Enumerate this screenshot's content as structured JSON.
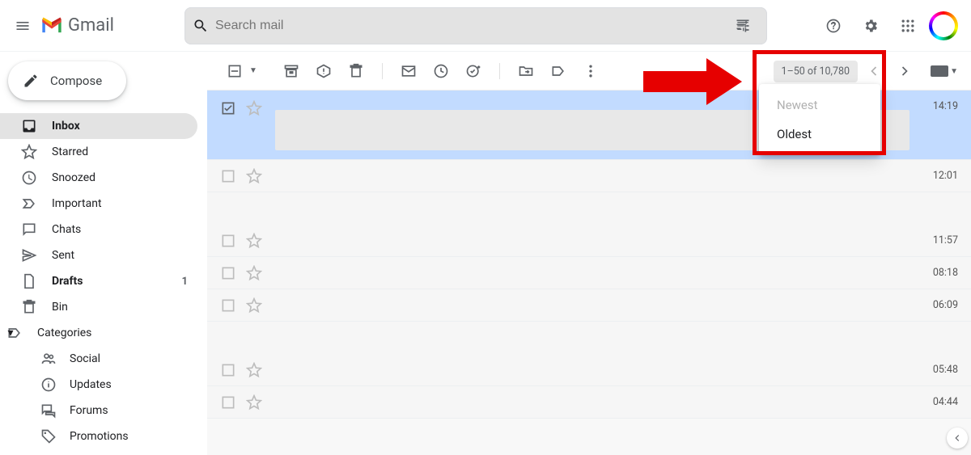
{
  "header": {
    "brand_text": "Gmail",
    "search_placeholder": "Search mail"
  },
  "compose": {
    "label": "Compose"
  },
  "sidebar": {
    "items": [
      {
        "id": "inbox",
        "label": "Inbox",
        "active": true,
        "bold": true
      },
      {
        "id": "starred",
        "label": "Starred"
      },
      {
        "id": "snoozed",
        "label": "Snoozed"
      },
      {
        "id": "important",
        "label": "Important"
      },
      {
        "id": "chats",
        "label": "Chats"
      },
      {
        "id": "sent",
        "label": "Sent"
      },
      {
        "id": "drafts",
        "label": "Drafts",
        "bold": true,
        "count": "1"
      },
      {
        "id": "bin",
        "label": "Bin"
      },
      {
        "id": "categories",
        "label": "Categories"
      }
    ],
    "categories": [
      {
        "id": "social",
        "label": "Social"
      },
      {
        "id": "updates",
        "label": "Updates"
      },
      {
        "id": "forums",
        "label": "Forums"
      },
      {
        "id": "promotions",
        "label": "Promotions"
      }
    ]
  },
  "toolbar": {
    "page_count": "1–50 of 10,780",
    "sort": {
      "newest": "Newest",
      "oldest": "Oldest"
    }
  },
  "emails": [
    {
      "selected": true,
      "time": "14:19"
    },
    {
      "selected": false,
      "time": "12:01"
    },
    {
      "selected": false,
      "time": "11:57"
    },
    {
      "selected": false,
      "time": "08:18"
    },
    {
      "selected": false,
      "time": "06:09"
    },
    {
      "selected": false,
      "time": "05:48"
    },
    {
      "selected": false,
      "time": "04:44"
    }
  ]
}
